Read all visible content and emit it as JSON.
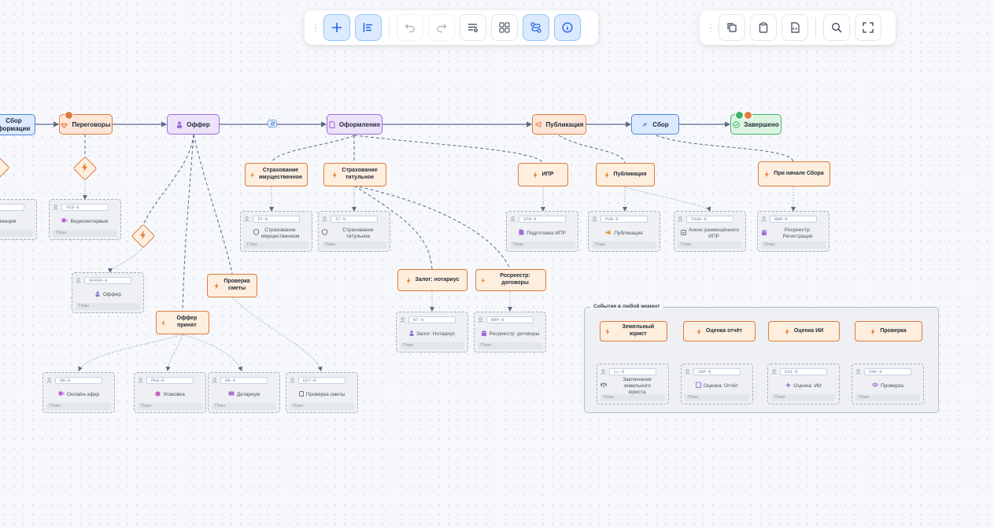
{
  "toolbar_left": {
    "buttons": [
      {
        "icon": "plus-icon",
        "active": true
      },
      {
        "icon": "align-left-icon",
        "active": true
      },
      {
        "icon": "undo-icon",
        "disabled": true
      },
      {
        "icon": "redo-icon",
        "disabled": true
      },
      {
        "icon": "list-settings-icon"
      },
      {
        "icon": "grid-icon"
      },
      {
        "icon": "route-icon",
        "active": true
      },
      {
        "icon": "info-icon",
        "active": true
      }
    ]
  },
  "toolbar_right": {
    "buttons": [
      {
        "icon": "copy-icon"
      },
      {
        "icon": "clipboard-icon"
      },
      {
        "icon": "file-code-icon"
      },
      {
        "icon": "search-icon"
      },
      {
        "icon": "fullscreen-icon"
      }
    ]
  },
  "stages": [
    {
      "id": "collect-info",
      "label_line1": "Сбор",
      "label_line2": "формации",
      "color": "blue",
      "icon": "user-icon"
    },
    {
      "id": "negotiations",
      "label": "Переговоры",
      "color": "orange",
      "icon": "handshake-icon"
    },
    {
      "id": "offer",
      "label": "Оффер",
      "color": "purple",
      "icon": "person-icon"
    },
    {
      "id": "registration",
      "label": "Оформление",
      "color": "purple",
      "icon": "document-icon"
    },
    {
      "id": "publication",
      "label": "Публикация",
      "color": "orange",
      "icon": "megaphone-icon"
    },
    {
      "id": "collection",
      "label": "Сбор",
      "color": "blue",
      "icon": "hand-icon"
    },
    {
      "id": "done",
      "label": "Завершено",
      "color": "green",
      "icon": "check-circle-icon"
    }
  ],
  "stage_badge_colors": {
    "warning": "#e07a3c",
    "success": "#3fb36a"
  },
  "triggers": [
    {
      "id": "t-property-ins",
      "line1": "Страхование",
      "line2": "имущественное"
    },
    {
      "id": "t-title-ins",
      "line1": "Страхование",
      "line2": "титульное"
    },
    {
      "id": "t-ipr",
      "line1": "ИПР",
      "line2": ""
    },
    {
      "id": "t-publication",
      "line1": "Публикация",
      "line2": ""
    },
    {
      "id": "t-collect-start",
      "line1": "При начале Сбора",
      "line2": ""
    },
    {
      "id": "t-notary",
      "line1": "Залог: нотариус",
      "line2": ""
    },
    {
      "id": "t-rosreestr-contracts",
      "line1": "Росреестр: договоры",
      "line2": ""
    },
    {
      "id": "t-estimate-check",
      "line1": "Проверка",
      "line2": "сметы"
    },
    {
      "id": "t-offer-accepted",
      "line1": "Оффер принят",
      "line2": ""
    },
    {
      "id": "t-land-lawyer",
      "line1": "Земельный юрист",
      "line2": ""
    },
    {
      "id": "t-report-eval",
      "line1": "Оценка отчёт",
      "line2": ""
    },
    {
      "id": "t-ii-eval",
      "line1": "Оценка ИИ",
      "line2": ""
    },
    {
      "id": "t-check",
      "line1": "Проверка",
      "line2": ""
    }
  ],
  "tasks": [
    {
      "id": "task-info",
      "code": "",
      "line1": "информации",
      "line2": "",
      "footer": "",
      "icon": ""
    },
    {
      "id": "task-video",
      "code": "VID-0",
      "line1": "Видеоинтервью",
      "line2": "",
      "footer": "План",
      "icon": "video-icon"
    },
    {
      "id": "task-offer",
      "code": "OFFER-0",
      "line1": "Оффер",
      "line2": "",
      "footer": "План",
      "icon": "people-icon"
    },
    {
      "id": "task-ip",
      "code": "IP-0",
      "line1": "Страхование",
      "line2": "имущественном",
      "footer": "План",
      "icon": "shield-icon"
    },
    {
      "id": "task-it",
      "code": "IT-0",
      "line1": "Страхование титульное",
      "line2": "",
      "footer": "План",
      "icon": "shield-icon"
    },
    {
      "id": "task-ipr",
      "code": "IPR-0",
      "line1": "Подготовка ИПР",
      "line2": "",
      "footer": "План",
      "icon": "document-icon"
    },
    {
      "id": "task-pub",
      "code": "PUB-0",
      "line1": "Публикация",
      "line2": "",
      "footer": "План",
      "icon": "megaphone-icon"
    },
    {
      "id": "task-announce",
      "code": "TASK-0",
      "line1": "Анонс размещённого",
      "line2": "ИПР",
      "footer": "План",
      "icon": "checkbox-icon"
    },
    {
      "id": "task-rrr",
      "code": "RRR-0",
      "line1": "Росреестр: Регистрация",
      "line2": "",
      "footer": "План",
      "icon": "bank-icon"
    },
    {
      "id": "task-nt",
      "code": "NT-0",
      "line1": "Залог: Нотариус",
      "line2": "",
      "footer": "План",
      "icon": "person-icon"
    },
    {
      "id": "task-rrp",
      "code": "RRP-0",
      "line1": "Росреестр: договоры",
      "line2": "",
      "footer": "План",
      "icon": "bank-icon"
    },
    {
      "id": "task-ob",
      "code": "OB-0",
      "line1": "Онлайн-эфир",
      "line2": "",
      "footer": "План",
      "icon": "video-icon"
    },
    {
      "id": "task-pkg",
      "code": "PKG-0",
      "line1": "Упаковка",
      "line2": "",
      "footer": "План",
      "icon": "package-icon"
    },
    {
      "id": "task-dr",
      "code": "DR-0",
      "line1": "Детариум",
      "line2": "",
      "footer": "План",
      "icon": "box-icon"
    },
    {
      "id": "task-est",
      "code": "EST-0",
      "line1": "Проверка сметы",
      "line2": "",
      "footer": "План",
      "icon": "calculator-icon"
    },
    {
      "id": "task-ll",
      "code": "LL-0",
      "line1": "Заключение земельного",
      "line2": "юриста",
      "footer": "План",
      "icon": "scales-icon"
    },
    {
      "id": "task-crp",
      "code": "CRP-0",
      "line1": "Оценка: Отчёт",
      "line2": "",
      "footer": "План",
      "icon": "clipboard-icon"
    },
    {
      "id": "task-cai",
      "code": "CAI-0",
      "line1": "Оценка: ИИ",
      "line2": "",
      "footer": "План",
      "icon": "sparkle-icon"
    },
    {
      "id": "task-chk",
      "code": "CHK-0",
      "line1": "Проверка",
      "line2": "",
      "footer": "План",
      "icon": "eye-icon"
    }
  ],
  "group": {
    "title": "События в любой момент"
  },
  "colors": {
    "edge": "#5b6b86",
    "edge_dotted": "#9aa6bb",
    "trigger_border": "#e07a3c",
    "trigger_fill": "#fdeedd"
  }
}
